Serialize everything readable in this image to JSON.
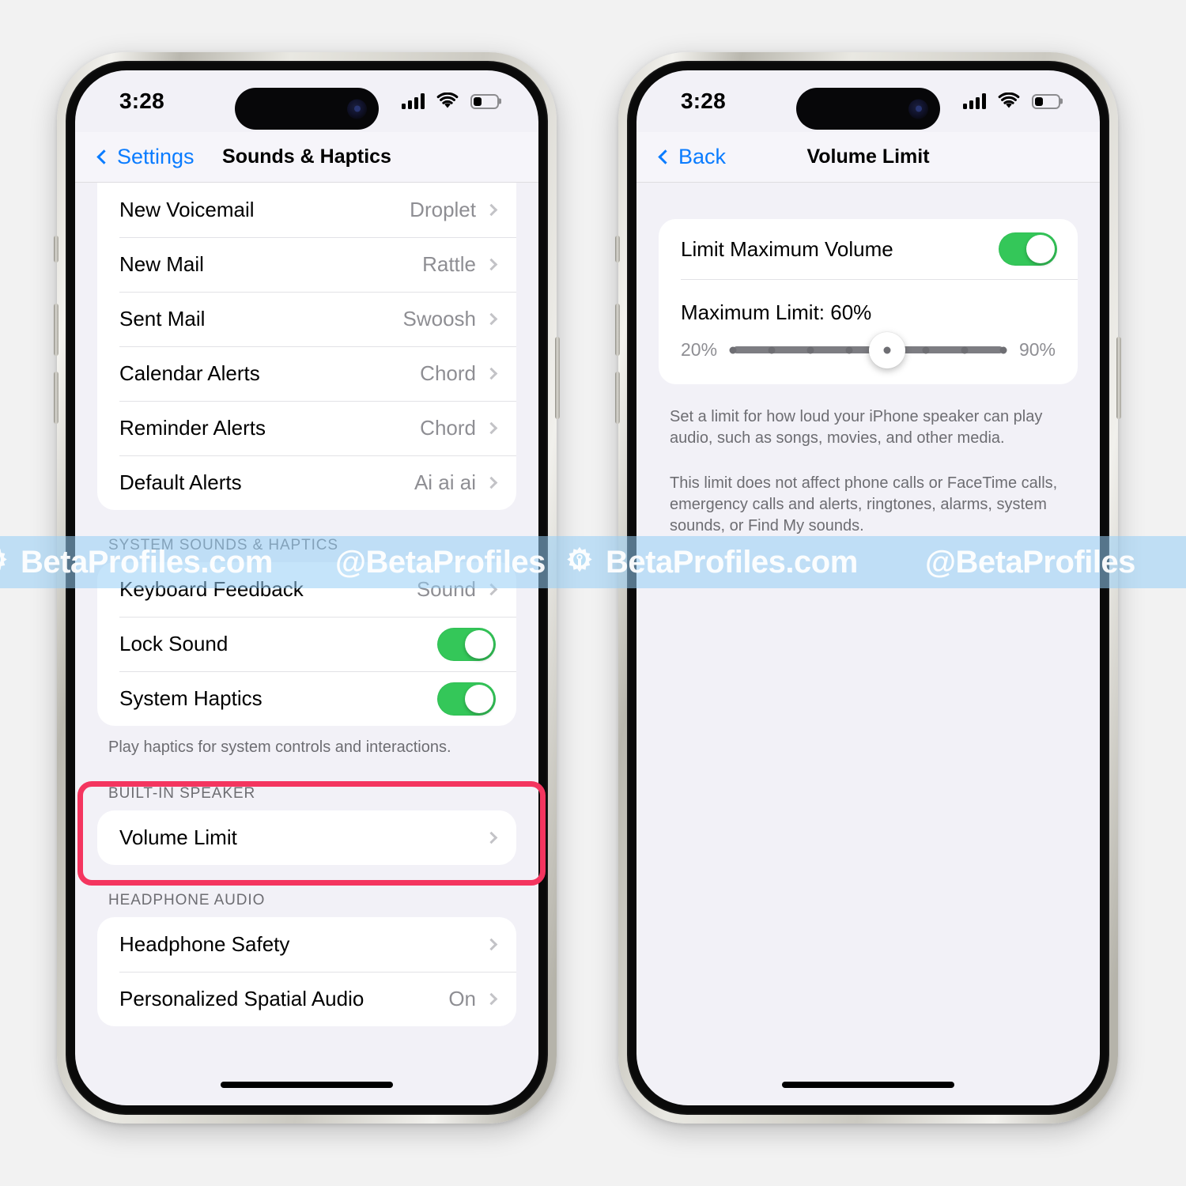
{
  "colors": {
    "accent_blue": "#0a7cff",
    "toggle_green": "#34c759",
    "highlight_red": "#f4355f",
    "secondary_text": "#8e8e93",
    "screen_bg": "#f2f1f7"
  },
  "left_phone": {
    "status_bar": {
      "time": "3:28",
      "cellular_icon": "signal-bars-icon",
      "wifi_icon": "wifi-icon",
      "battery_icon": "battery-icon",
      "battery_level_pct": 30
    },
    "nav": {
      "back_label": "Settings",
      "back_icon": "chevron-left-icon",
      "title": "Sounds & Haptics"
    },
    "sound_rows": [
      {
        "label": "New Voicemail",
        "value": "Droplet"
      },
      {
        "label": "New Mail",
        "value": "Rattle"
      },
      {
        "label": "Sent Mail",
        "value": "Swoosh"
      },
      {
        "label": "Calendar Alerts",
        "value": "Chord"
      },
      {
        "label": "Reminder Alerts",
        "value": "Chord"
      },
      {
        "label": "Default Alerts",
        "value": "Ai ai ai"
      }
    ],
    "system_section": {
      "header": "SYSTEM SOUNDS & HAPTICS",
      "footer": "Play haptics for system controls and interactions.",
      "rows": [
        {
          "label": "Keyboard Feedback",
          "value": "Sound",
          "type": "disclosure"
        },
        {
          "label": "Lock Sound",
          "value": "On",
          "type": "toggle"
        },
        {
          "label": "System Haptics",
          "value": "On",
          "type": "toggle"
        }
      ]
    },
    "speaker_section": {
      "header": "BUILT-IN SPEAKER",
      "rows": [
        {
          "label": "Volume Limit",
          "value": "",
          "type": "disclosure"
        }
      ]
    },
    "headphone_section": {
      "header": "HEADPHONE AUDIO",
      "rows": [
        {
          "label": "Headphone Safety",
          "value": "",
          "type": "disclosure"
        },
        {
          "label": "Personalized Spatial Audio",
          "value": "On",
          "type": "disclosure"
        }
      ]
    }
  },
  "right_phone": {
    "status_bar": {
      "time": "3:28",
      "cellular_icon": "signal-bars-icon",
      "wifi_icon": "wifi-icon",
      "battery_icon": "battery-icon",
      "battery_level_pct": 30
    },
    "nav": {
      "back_label": "Back",
      "back_icon": "chevron-left-icon",
      "title": "Volume Limit"
    },
    "card": {
      "toggle_label": "Limit Maximum Volume",
      "toggle_state": "On",
      "max_limit_label": "Maximum Limit: 60%",
      "slider": {
        "min_label": "20%",
        "max_label": "90%",
        "min": 20,
        "max": 90,
        "value": 60,
        "step": 10,
        "ticks": [
          20,
          30,
          40,
          50,
          60,
          70,
          80,
          90
        ]
      }
    },
    "footer_paragraph_1": "Set a limit for how loud your iPhone speaker can play audio, such as songs, movies, and other media.",
    "footer_paragraph_2": "This limit does not affect phone calls or FaceTime calls, emergency calls and alerts, ringtones, alarms, system sounds, or Find My sounds."
  },
  "watermark": {
    "items": [
      "BetaProfiles.com",
      "@BetaProfiles",
      "BetaProfiles.com",
      "@BetaProfiles"
    ],
    "logo_icon": "gear-wrench-icon"
  }
}
